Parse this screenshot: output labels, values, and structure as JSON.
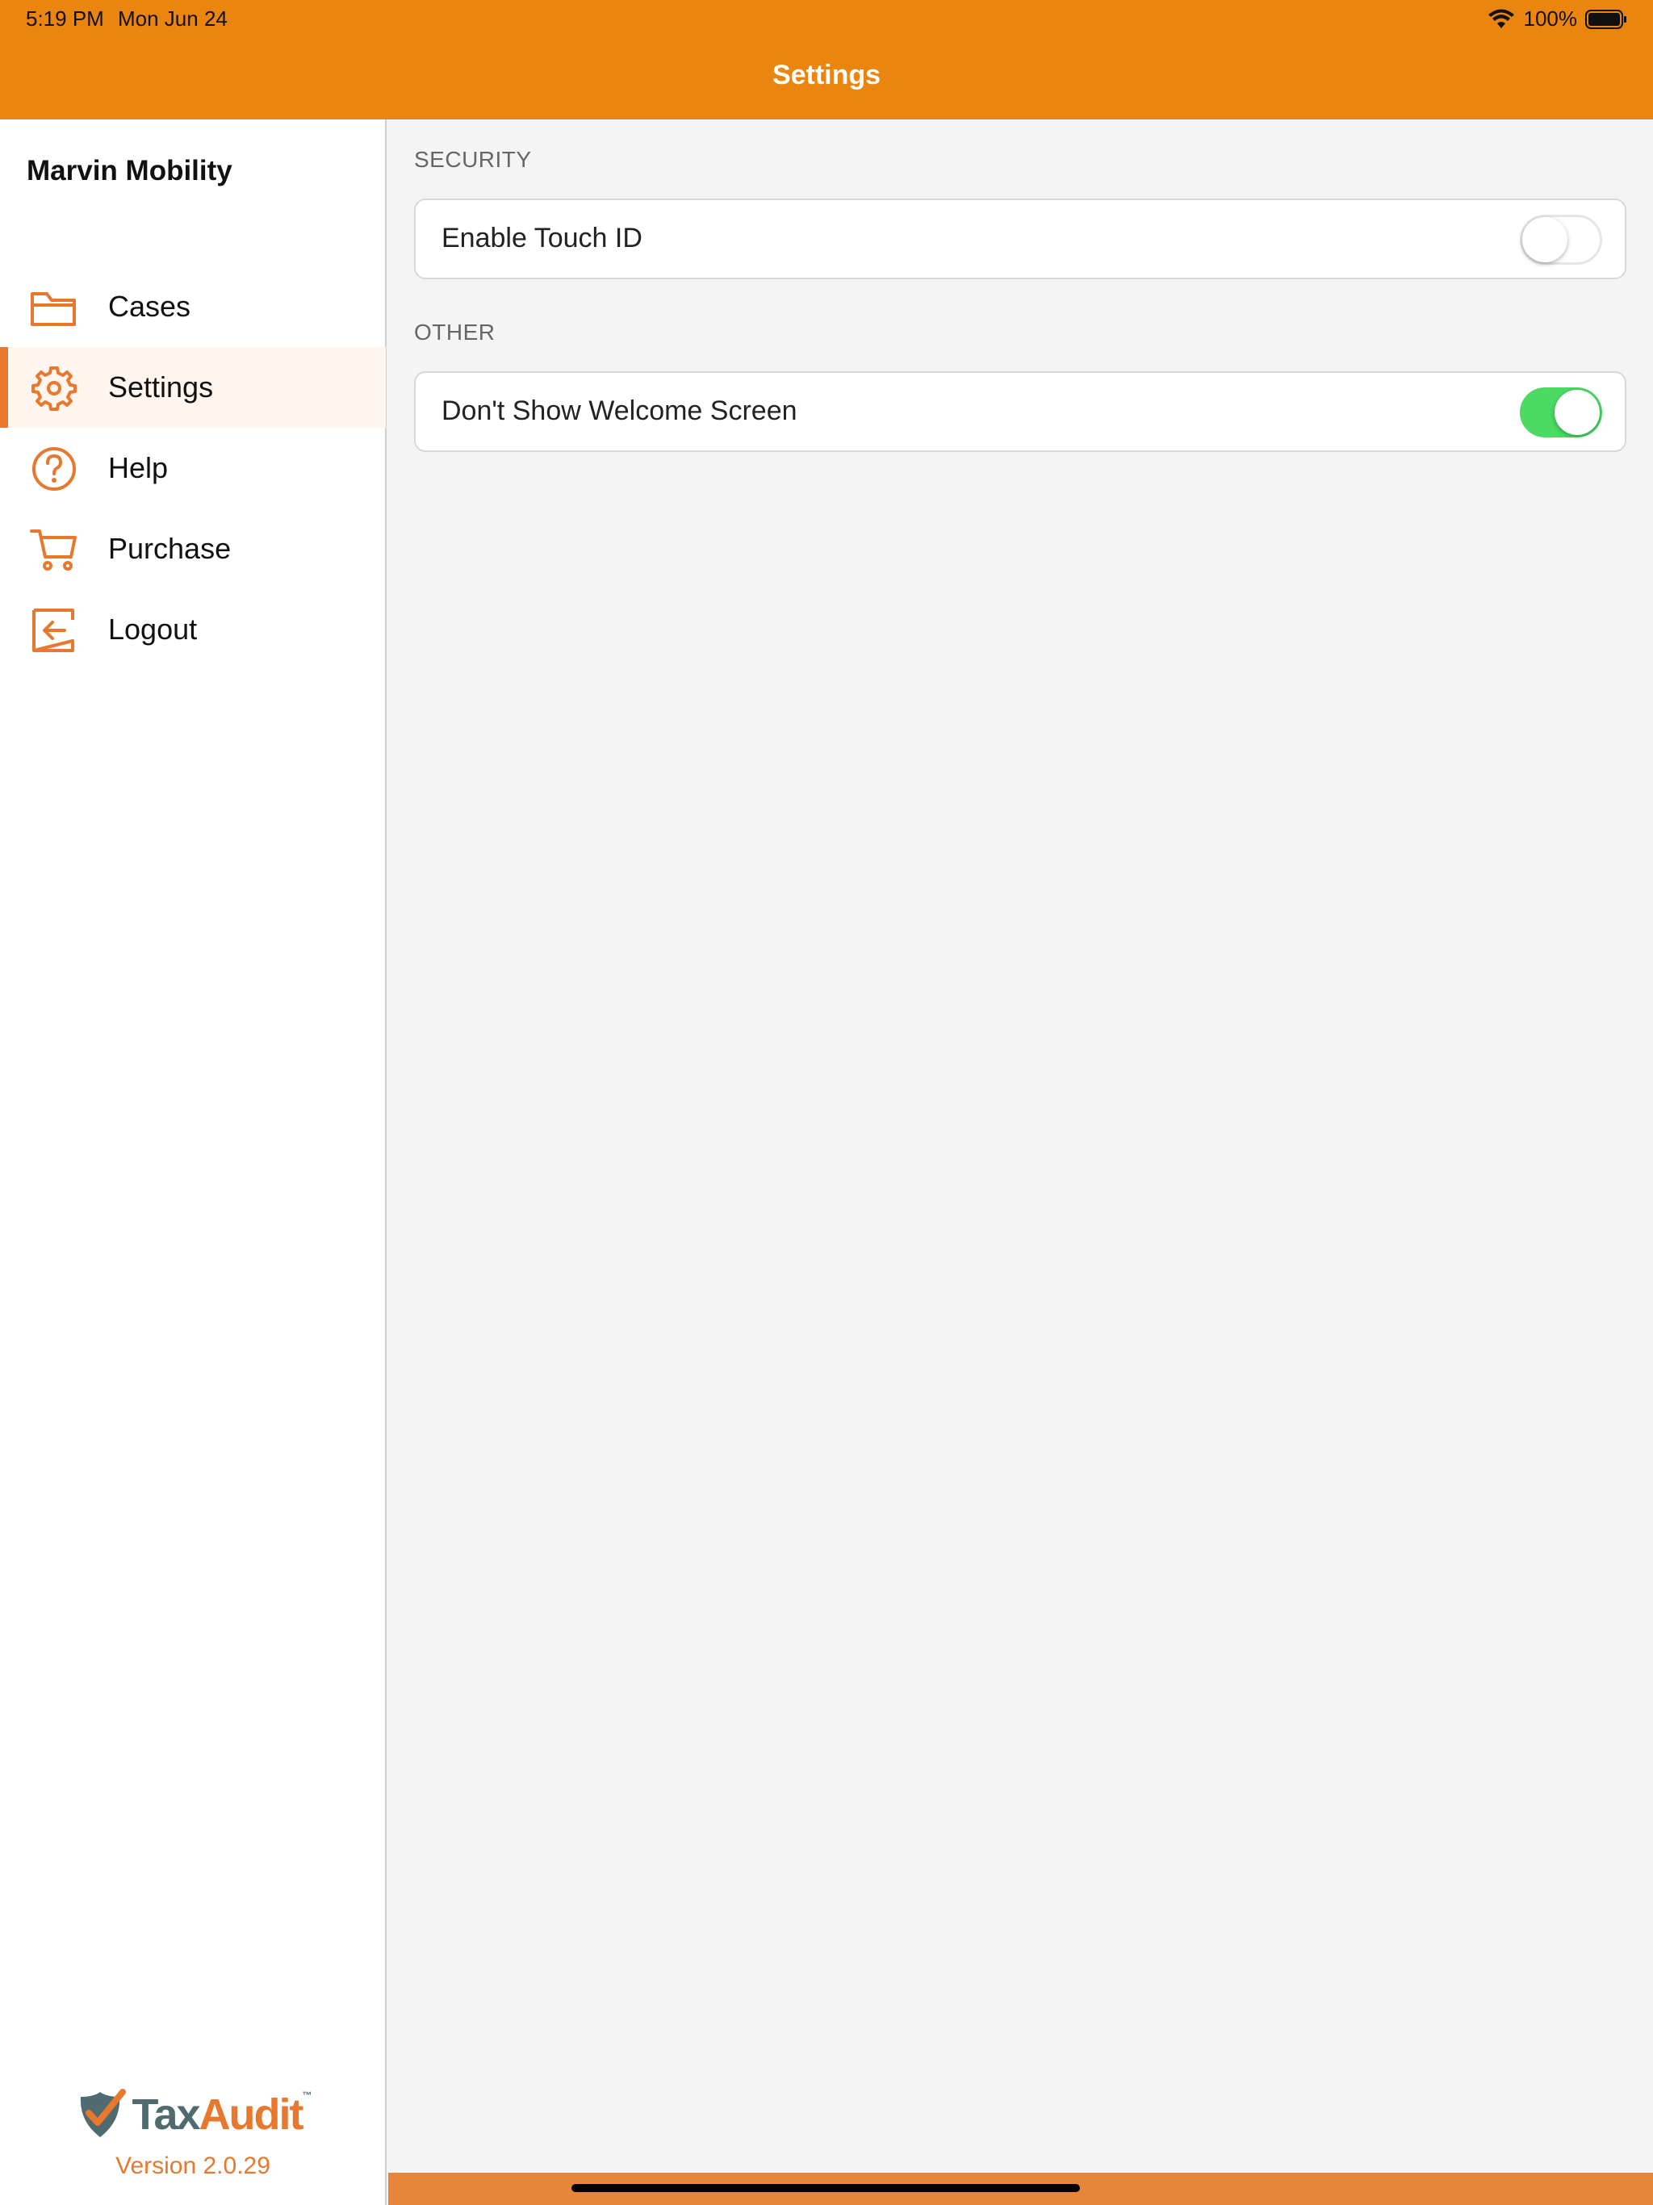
{
  "status_bar": {
    "time": "5:19 PM",
    "date": "Mon Jun 24",
    "battery": "100%"
  },
  "nav": {
    "title": "Settings"
  },
  "sidebar": {
    "account_name": "Marvin Mobility",
    "items": [
      {
        "label": "Cases",
        "icon": "folder-icon"
      },
      {
        "label": "Settings",
        "icon": "gear-icon",
        "active": true
      },
      {
        "label": "Help",
        "icon": "question-circle-icon"
      },
      {
        "label": "Purchase",
        "icon": "cart-icon"
      },
      {
        "label": "Logout",
        "icon": "logout-icon"
      }
    ],
    "brand": {
      "name_part1": "Tax",
      "name_part2": "Audit",
      "tm": "™",
      "version": "Version 2.0.29"
    }
  },
  "settings": {
    "sections": [
      {
        "header": "SECURITY",
        "rows": [
          {
            "label": "Enable Touch ID",
            "enabled": false
          }
        ]
      },
      {
        "header": "OTHER",
        "rows": [
          {
            "label": "Don't Show Welcome Screen",
            "enabled": true
          }
        ]
      }
    ]
  },
  "colors": {
    "nav_bar": "#ea8510",
    "accent": "#e7782d",
    "toggle_on": "#4cd964",
    "logo_gray": "#4f6b70"
  }
}
